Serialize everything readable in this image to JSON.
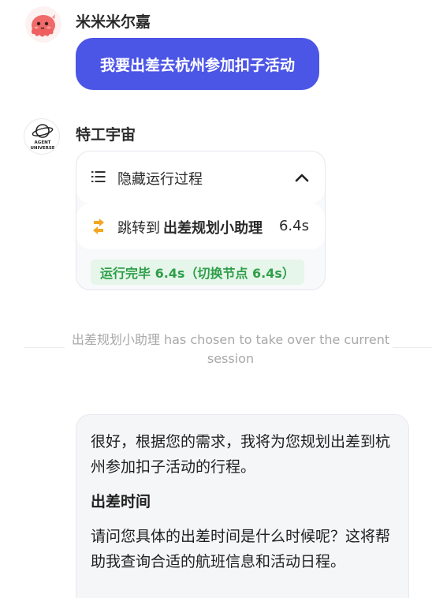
{
  "user": {
    "name": "米米米尔嘉",
    "avatar_icon": "pink-octopus-avatar",
    "message": "我要出差去杭州参加扣子活动"
  },
  "agent": {
    "name": "特工宇宙",
    "avatar_icon": "planet-logo-avatar",
    "avatar_text_line1": "AGENT",
    "avatar_text_line2": "UNIVERSE"
  },
  "process": {
    "header_label": "隐藏运行过程",
    "list_icon": "list-icon",
    "toggle_icon": "chevron-up-icon",
    "step_prefix": "跳转到",
    "step_target": "出差规划小助理",
    "step_time": "6.4s",
    "step_icon": "jump-icon",
    "done_text": "运行完毕 6.4s（切换节点 6.4s）"
  },
  "notice": {
    "text": "出差规划小助理 has chosen to take over the current session"
  },
  "reply": {
    "paragraph1": "很好，根据您的需求，我将为您规划出差到杭州参加扣子活动的行程。",
    "heading": "出差时间",
    "paragraph2": "请问您具体的出差时间是什么时候呢？这将帮助我查询合适的航班信息和活动日程。"
  },
  "colors": {
    "accent": "#4b55e6",
    "success": "#2f9e4a",
    "success_bg": "#e6f6ea",
    "jump_icon": "#f5a623"
  }
}
